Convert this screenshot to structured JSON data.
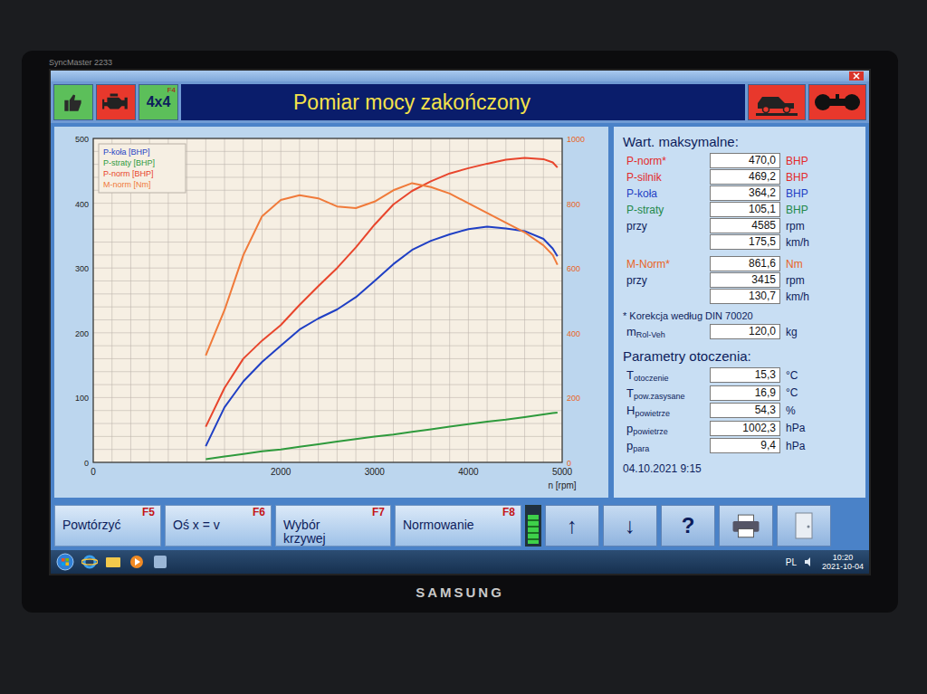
{
  "monitor": {
    "model": "SyncMaster 2233",
    "brand": "SAMSUNG"
  },
  "window": {
    "title": "Pomiar mocy zakończony"
  },
  "toolbar_left": [
    {
      "kind": "thumb",
      "color": "#5cbf5a"
    },
    {
      "kind": "engine",
      "color": "#e8382c"
    },
    {
      "kind": "text",
      "label": "4x4",
      "hotkey": "F4",
      "color": "#5cbf5a"
    }
  ],
  "toolbar_right": [
    {
      "kind": "dyno",
      "color": "#e8382c"
    },
    {
      "kind": "motor",
      "color": "#e8382c"
    }
  ],
  "chart": {
    "x_axis": {
      "title": "n [rpm]",
      "min": 0,
      "max": 5000,
      "ticks": [
        "0",
        "2000",
        "3000",
        "4000",
        "5000"
      ]
    },
    "left_axis": {
      "max": 500,
      "ticks": [
        "0",
        "100",
        "200",
        "300",
        "400",
        "500"
      ]
    },
    "right_axis": {
      "max": 1000,
      "ticks": [
        "0",
        "200",
        "400",
        "600",
        "800",
        "1000"
      ]
    },
    "rpm": [
      1200,
      1400,
      1600,
      1800,
      2000,
      2200,
      2400,
      2600,
      2800,
      3000,
      3200,
      3400,
      3600,
      3800,
      4000,
      4200,
      4400,
      4600,
      4800,
      4900,
      4950
    ],
    "series": [
      {
        "name": "P-koła [BHP]",
        "color": "#1f3fc4",
        "axis": "left",
        "values": [
          25,
          85,
          125,
          155,
          180,
          205,
          222,
          236,
          255,
          280,
          306,
          328,
          342,
          352,
          360,
          364,
          361,
          357,
          345,
          330,
          318
        ]
      },
      {
        "name": "P-straty [BHP]",
        "color": "#2e9a3c",
        "axis": "left",
        "values": [
          5,
          9,
          13,
          17,
          20,
          24,
          28,
          32,
          36,
          40,
          43,
          47,
          51,
          55,
          59,
          63,
          66,
          70,
          74,
          76,
          77
        ]
      },
      {
        "name": "P-norm [BHP]",
        "color": "#e8452c",
        "axis": "left",
        "values": [
          55,
          115,
          160,
          188,
          212,
          243,
          272,
          300,
          332,
          367,
          398,
          419,
          434,
          446,
          454,
          461,
          467,
          470,
          468,
          463,
          455
        ]
      },
      {
        "name": "M-norm [Nm]",
        "color": "#f07a3a",
        "axis": "right",
        "values": [
          330,
          470,
          640,
          760,
          810,
          825,
          815,
          790,
          785,
          805,
          840,
          862,
          850,
          830,
          800,
          770,
          740,
          710,
          670,
          640,
          610
        ]
      }
    ]
  },
  "max_values": {
    "heading": "Wart. maksymalne:",
    "power_rows": [
      {
        "label": "P-norm*",
        "value": "470,0",
        "unit": "BHP",
        "color": "#e32b2b"
      },
      {
        "label": "P-silnik",
        "value": "469,2",
        "unit": "BHP",
        "color": "#e32b2b"
      },
      {
        "label": "P-koła",
        "value": "364,2",
        "unit": "BHP",
        "color": "#1f3fc4"
      },
      {
        "label": "P-straty",
        "value": "105,1",
        "unit": "BHP",
        "color": "#23894a"
      },
      {
        "label": "przy",
        "value": "4585",
        "unit": "rpm",
        "color": "#0d1d5c"
      },
      {
        "value": "175,5",
        "unit": "km/h",
        "color": "#0d1d5c"
      }
    ],
    "torque_rows": [
      {
        "label": "M-Norm*",
        "value": "861,6",
        "unit": "Nm",
        "color": "#e8641e"
      },
      {
        "label": "przy",
        "value": "3415",
        "unit": "rpm",
        "color": "#0d1d5c"
      },
      {
        "value": "130,7",
        "unit": "km/h",
        "color": "#0d1d5c"
      }
    ]
  },
  "note": "* Korekcja według DIN 70020",
  "mass": {
    "symbol": "m",
    "sub": "Rol-Veh",
    "value": "120,0",
    "unit": "kg"
  },
  "ambient": {
    "heading": "Parametry otoczenia:",
    "rows": [
      {
        "symbol": "T",
        "sub": "otoczenie",
        "value": "15,3",
        "unit": "°C"
      },
      {
        "symbol": "T",
        "sub": "pow.zasysane",
        "value": "16,9",
        "unit": "°C"
      },
      {
        "symbol": "H",
        "sub": "powietrze",
        "value": "54,3",
        "unit": "%"
      },
      {
        "symbol": "p",
        "sub": "powietrze",
        "value": "1002,3",
        "unit": "hPa"
      },
      {
        "symbol": "p",
        "sub": "para",
        "value": "9,4",
        "unit": "hPa"
      }
    ]
  },
  "timestamp": "04.10.2021 9:15",
  "function_keys": [
    {
      "label": "Powtórzyć",
      "key": "F5"
    },
    {
      "label": "Oś x = v",
      "key": "F6"
    },
    {
      "label": "Wybór krzywej",
      "key": "F7"
    },
    {
      "label": "Normowanie",
      "key": "F8"
    }
  ],
  "indicator": {
    "level": 0.8
  },
  "tool_buttons": [
    {
      "kind": "glyph",
      "label": "↑"
    },
    {
      "kind": "glyph",
      "label": "↓"
    },
    {
      "kind": "glyph",
      "label": "?"
    },
    {
      "kind": "printer"
    },
    {
      "kind": "exit"
    }
  ],
  "taskbar": {
    "apps": [
      {
        "kind": "ie"
      },
      {
        "kind": "explorer"
      },
      {
        "kind": "media"
      },
      {
        "kind": "tool"
      }
    ],
    "language": "PL",
    "time": "10:20",
    "date": "2021-10-04"
  }
}
